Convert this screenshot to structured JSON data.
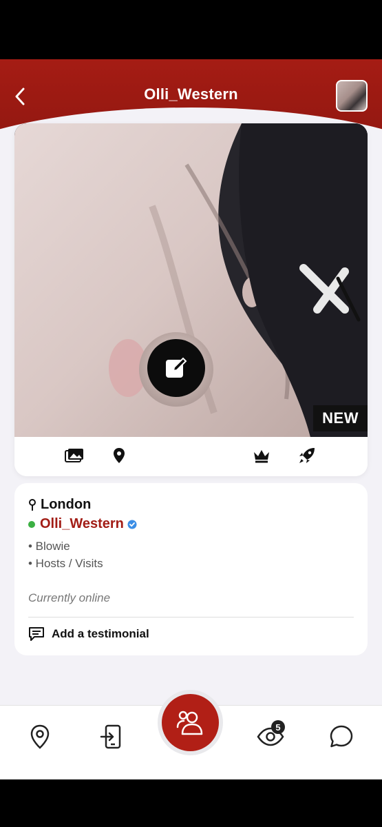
{
  "header": {
    "title": "Olli_Western"
  },
  "profile_card": {
    "badge": "NEW",
    "actions": [
      "photos-icon",
      "location-pin-icon",
      "edit-icon",
      "crown-icon",
      "rocket-icon"
    ]
  },
  "info": {
    "location": "London",
    "username": "Olli_Western",
    "tags": [
      "• Blowie",
      "• Hosts / Visits"
    ],
    "status": "Currently online",
    "testimonial_label": "Add a testimonial"
  },
  "tabbar": {
    "items": [
      "map-pin-icon",
      "check-in-icon",
      "people-icon",
      "eye-icon",
      "chat-icon"
    ],
    "views_count": "5"
  },
  "colors": {
    "brand": "#a51c14",
    "online": "#3cb043",
    "verified": "#3b8ee6"
  }
}
